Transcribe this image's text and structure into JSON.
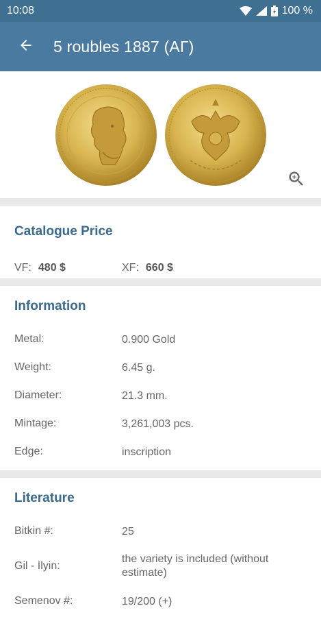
{
  "status": {
    "time": "10:08",
    "battery": "100 %"
  },
  "header": {
    "title": "5 roubles 1887 (АГ)"
  },
  "icons": {
    "back": "arrow-left-icon",
    "zoom": "zoom-in-icon",
    "wifi": "wifi-icon",
    "signal": "cellular-signal-icon",
    "battery": "battery-icon"
  },
  "catalogue": {
    "title": "Catalogue Price",
    "prices": [
      {
        "label": "VF:",
        "value": "480 $"
      },
      {
        "label": "XF:",
        "value": "660 $"
      }
    ]
  },
  "information": {
    "title": "Information",
    "rows": [
      {
        "label": "Metal:",
        "value": "0.900 Gold"
      },
      {
        "label": "Weight:",
        "value": "6.45 g."
      },
      {
        "label": "Diameter:",
        "value": "21.3 mm."
      },
      {
        "label": "Mintage:",
        "value": "3,261,003 pcs."
      },
      {
        "label": "Edge:",
        "value": "inscription"
      }
    ]
  },
  "literature": {
    "title": "Literature",
    "rows": [
      {
        "label": "Bitkin #:",
        "value": "25"
      },
      {
        "label": "Gil - Ilyin:",
        "value": "the variety is included (without estimate)"
      },
      {
        "label": "Semenov #:",
        "value": "19/200 (+)"
      }
    ]
  },
  "colors": {
    "status_bar": "#3f6f91",
    "app_bar": "#4a7aa0",
    "section_title": "#3a6a8f",
    "divider": "#e9e9e9",
    "gold": "#d8b44f"
  }
}
